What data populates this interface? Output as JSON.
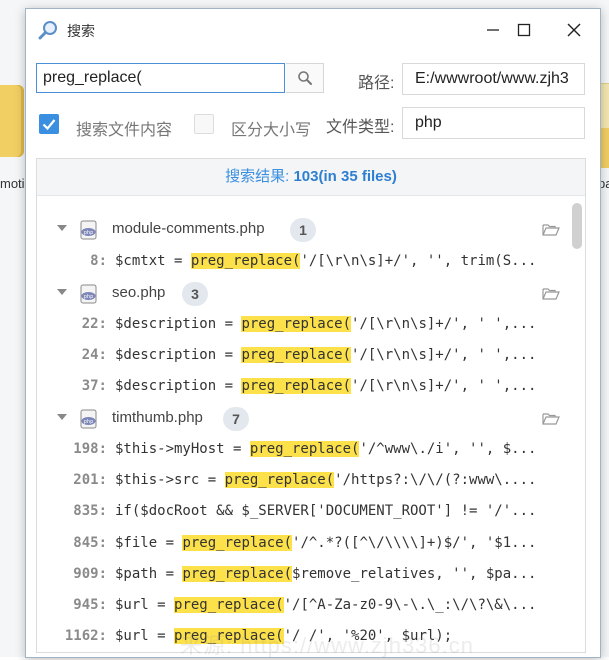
{
  "window": {
    "title": "搜索"
  },
  "search": {
    "value": "preg_replace("
  },
  "path": {
    "label": "路径:",
    "value": "E:/wwwroot/www.zjh3"
  },
  "filetype": {
    "label": "文件类型:",
    "value": "php"
  },
  "options": {
    "search_content": {
      "label": "搜索文件内容",
      "checked": true
    },
    "case_sensitive": {
      "label": "区分大小写",
      "checked": false
    }
  },
  "results": {
    "header_prefix": "搜索结果: ",
    "header_summary": "103(in 35 files)",
    "files": [
      {
        "name": "module-comments.php",
        "count": "1",
        "lines": [
          {
            "no": "8:",
            "pre": "$cmtxt = ",
            "hl": "preg_replace(",
            "post": "'/[\\r\\n\\s]+/', '', trim(S..."
          }
        ]
      },
      {
        "name": "seo.php",
        "count": "3",
        "lines": [
          {
            "no": "22:",
            "pre": "$description = ",
            "hl": "preg_replace(",
            "post": "'/[\\r\\n\\s]+/', ' ',..."
          },
          {
            "no": "24:",
            "pre": "$description = ",
            "hl": "preg_replace(",
            "post": "'/[\\r\\n\\s]+/', ' ',..."
          },
          {
            "no": "37:",
            "pre": "$description = ",
            "hl": "preg_replace(",
            "post": "'/[\\r\\n\\s]+/', ' ',..."
          }
        ]
      },
      {
        "name": "timthumb.php",
        "count": "7",
        "lines": [
          {
            "no": "198:",
            "pre": "$this->myHost = ",
            "hl": "preg_replace(",
            "post": "'/^www\\./i', '', $..."
          },
          {
            "no": "201:",
            "pre": "$this->src = ",
            "hl": "preg_replace(",
            "post": "'/https?:\\/\\/(?:www\\...."
          },
          {
            "no": "835:",
            "pre": "if($docRoot && $_SERVER['DOCUMENT_ROOT'] != '/'...",
            "hl": "",
            "post": ""
          },
          {
            "no": "845:",
            "pre": "$file = ",
            "hl": "preg_replace(",
            "post": "'/^.*?([^\\/\\\\\\\\]+)$/', '$1..."
          },
          {
            "no": "909:",
            "pre": "$path = ",
            "hl": "preg_replace(",
            "post": "$remove_relatives, '', $pa..."
          },
          {
            "no": "945:",
            "pre": "$url = ",
            "hl": "preg_replace(",
            "post": "'/[^A-Za-z0-9\\-\\.\\_:\\/\\?\\&\\..."
          },
          {
            "no": "1162:",
            "pre": "$url = ",
            "hl": "preg_replace(",
            "post": "'/ /', '%20', $url);"
          }
        ]
      }
    ]
  },
  "background": {
    "left_label": "moti",
    "right_label": "pa"
  },
  "watermark": "来源: https://www.zjh336.cn"
}
